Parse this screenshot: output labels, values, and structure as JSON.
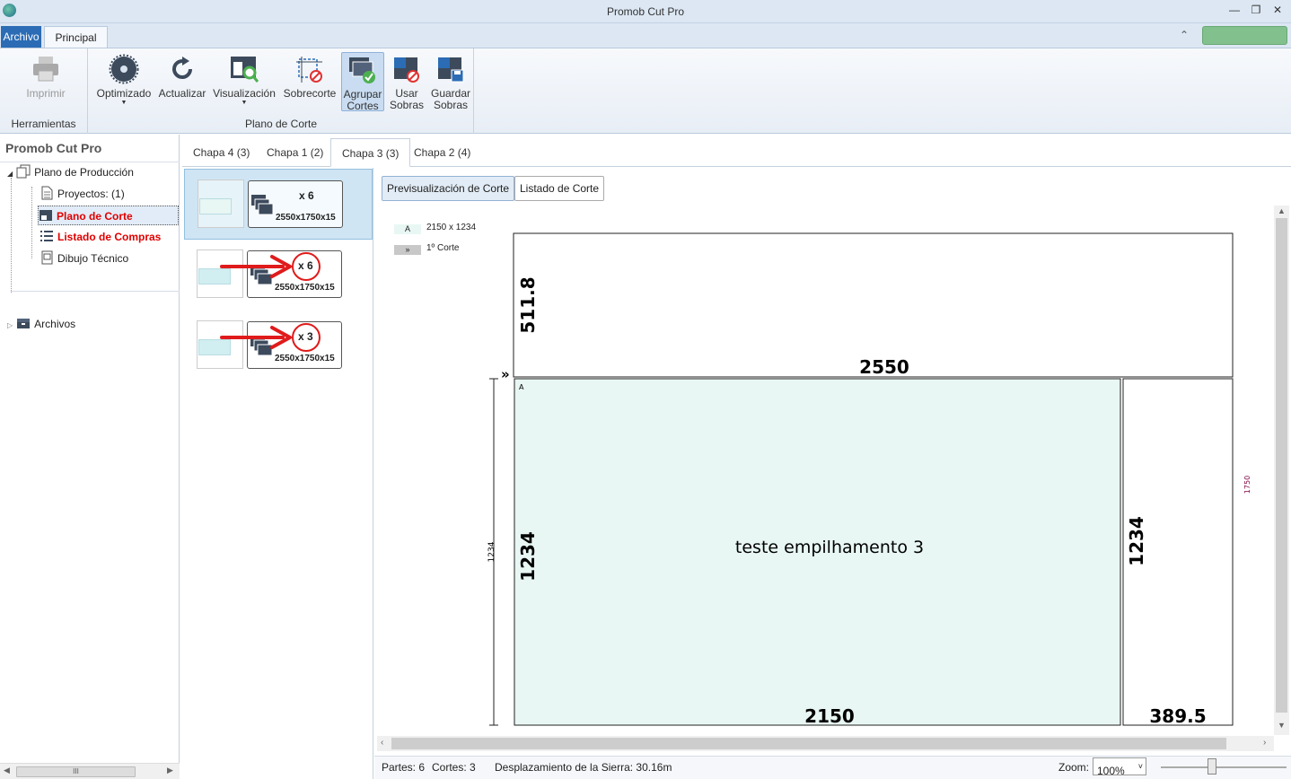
{
  "window": {
    "title": "Promob Cut Pro"
  },
  "ribbon_tabs": {
    "file": "Archivo",
    "main": "Principal"
  },
  "ribbon": {
    "group_tools": {
      "label": "Herramientas",
      "print": "Imprimir"
    },
    "group_cut_plan": {
      "label": "Plano de Corte",
      "optimized": "Optimizado",
      "refresh": "Actualizar",
      "view": "Visualización",
      "overcut": "Sobrecorte",
      "group_cuts_1": "Agrupar",
      "group_cuts_2": "Cortes",
      "use_leftovers_1": "Usar",
      "use_leftovers_2": "Sobras",
      "save_leftovers_1": "Guardar",
      "save_leftovers_2": "Sobras"
    }
  },
  "sidebar": {
    "title": "Promob Cut Pro",
    "production_plan": "Plano de Producción",
    "projects": "Proyectos: (1)",
    "cut_plan": "Plano de Corte",
    "shopping_list": "Listado de Compras",
    "technical_drawing": "Dibujo Técnico",
    "archives": "Archivos",
    "scroll_grip": "III"
  },
  "doc_tabs": [
    {
      "label": "Chapa 4 (3)"
    },
    {
      "label": "Chapa 1 (2)"
    },
    {
      "label": "Chapa 3 (3)"
    },
    {
      "label": "Chapa 2 (4)"
    }
  ],
  "sheets": [
    {
      "qty": "x 6",
      "dims": "2550x1750x15"
    },
    {
      "qty": "x 6",
      "dims": "2550x1750x15"
    },
    {
      "qty": "x 3",
      "dims": "2550x1750x15"
    }
  ],
  "view_buttons": {
    "preview": "Previsualización de Corte",
    "list": "Listado de Corte"
  },
  "legend": {
    "piece_tag": "A",
    "piece_size": "2150 x 1234",
    "cut_tag": "»",
    "cut_label": "1º Corte"
  },
  "cut_plan": {
    "top_strip_height": "511.8",
    "top_strip_width": "2550",
    "cut_marker": "»",
    "piece_tag": "A",
    "piece_label": "teste empilhamento 3",
    "piece_height": "1234",
    "piece_width": "2150",
    "remnant_height": "1234",
    "remnant_width": "389.5",
    "dim_left": "1234",
    "dim_right": "1750"
  },
  "status": {
    "parts": "Partes: 6",
    "cuts": "Cortes: 3",
    "saw": "Desplazamiento de la Sierra: 30.16m",
    "zoom_label": "Zoom:",
    "zoom_value": "100%"
  },
  "colors": {
    "accent": "#2b6cb5",
    "piece_fill": "#e8f7f3",
    "highlight": "#e01b1b",
    "label_red": "#e00000"
  }
}
